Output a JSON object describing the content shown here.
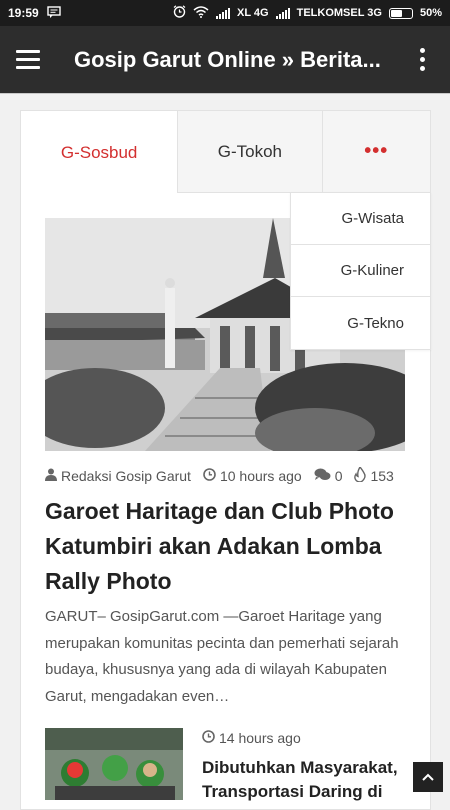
{
  "status_bar": {
    "time": "19:59",
    "carrier1": "XL 4G",
    "carrier2": "TELKOMSEL 3G",
    "battery": "50%"
  },
  "app_bar": {
    "title": "Gosip Garut Online » Berita..."
  },
  "tabs": [
    {
      "label": "G-Sosbud",
      "active": true
    },
    {
      "label": "G-Tokoh",
      "active": false
    },
    {
      "label": "•••",
      "active": false
    }
  ],
  "dropdown": {
    "items": [
      "G-Wisata",
      "G-Kuliner",
      "G-Tekno"
    ]
  },
  "article": {
    "author": "Redaksi Gosip Garut",
    "time": "10 hours ago",
    "comments": "0",
    "views": "153",
    "title": "Garoet Haritage dan Club Photo Katumbiri akan Adakan Lomba Rally Photo",
    "excerpt": "GARUT– GosipGarut.com —Garoet Haritage yang merupakan komunitas pecinta dan pemerhati sejarah budaya, khususnya yang ada di wilayah Kabupaten Garut, mengadakan even…"
  },
  "second_article": {
    "time": "14 hours ago",
    "title": "Dibutuhkan Masyarakat, Transportasi Daring di"
  },
  "colors": {
    "accent": "#d32f2f",
    "app_bar": "#2d2d2d",
    "status_bar": "#1c1c1c"
  },
  "icons": {
    "menu": "hamburger-icon",
    "overflow": "kebab-icon",
    "author": "user-icon",
    "time": "clock-icon",
    "comments": "comments-icon",
    "views": "fire-icon",
    "back_to_top": "chevron-up-icon"
  }
}
